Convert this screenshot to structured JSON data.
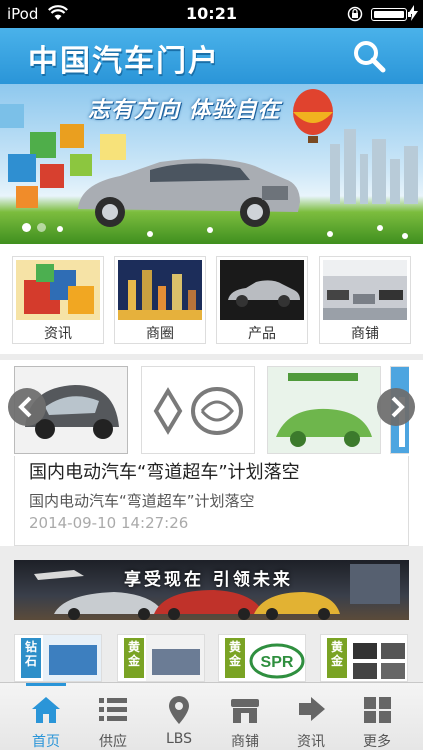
{
  "status_bar": {
    "carrier": "iPod",
    "time": "10:21",
    "wifi_icon": "wifi-icon",
    "lock_icon": "rotation-lock-icon",
    "battery_icon": "battery-charging-icon"
  },
  "header": {
    "title": "中国汽车门户",
    "search_icon": "search-icon",
    "background": "#2a95d8"
  },
  "banner": {
    "slogan": "志有方向 体验自在",
    "slides": 2,
    "active_slide": 1
  },
  "categories": [
    {
      "label": "资讯"
    },
    {
      "label": "商圈"
    },
    {
      "label": "产品"
    },
    {
      "label": "商铺"
    }
  ],
  "news": {
    "title": "国内电动汽车“弯道超车”计划落空",
    "subtitle": "国内电动汽车“弯道超车”计划落空",
    "time": "2014-09-10 14:27:26",
    "prev_icon": "chevron-left-icon",
    "next_icon": "chevron-right-icon"
  },
  "ad": {
    "slogan": "享受现在  引领未来"
  },
  "brands": [
    {
      "tag": "钻石"
    },
    {
      "tag": "黄金"
    },
    {
      "tag": "黄金"
    },
    {
      "tag": "黄金"
    }
  ],
  "tabbar": {
    "items": [
      {
        "label": "首页",
        "icon": "home-icon",
        "active": true
      },
      {
        "label": "供应",
        "icon": "list-icon",
        "active": false
      },
      {
        "label": "LBS",
        "icon": "location-pin-icon",
        "active": false
      },
      {
        "label": "商铺",
        "icon": "store-icon",
        "active": false
      },
      {
        "label": "资讯",
        "icon": "news-icon",
        "active": false
      },
      {
        "label": "更多",
        "icon": "grid-icon",
        "active": false
      }
    ],
    "accent": "#2a95d8"
  }
}
